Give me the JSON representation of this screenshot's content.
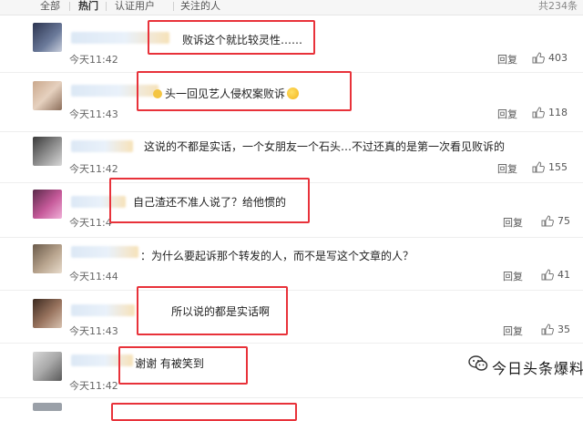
{
  "tabs": [
    "全部",
    "热门",
    "认证用户",
    "关注的人"
  ],
  "active_tab": "热门",
  "total_count": "共234条",
  "reply_label": "回复",
  "comments": [
    {
      "text": "败诉这个就比较灵性……",
      "time": "今天11:42",
      "likes": "403"
    },
    {
      "text": "头一回见艺人侵权案败诉",
      "time": "今天11:43",
      "likes": "118"
    },
    {
      "text": "这说的不都是实话，一个女朋友一个石头…不过还真的是第一次看见败诉的",
      "time": "今天11:42",
      "likes": "155"
    },
    {
      "text": "自己渣还不准人说了？给他惯的",
      "time": "今天11:4",
      "likes": "75"
    },
    {
      "text": "：为什么要起诉那个转发的人，而不是写这个文章的人？",
      "time": "今天11:44",
      "likes": "41"
    },
    {
      "text": "所以说的都是实话啊",
      "time": "今天11:43",
      "likes": "35"
    },
    {
      "text": "谢谢 有被笑到",
      "time": "今天11:42",
      "likes": ""
    }
  ],
  "watermark": "今日头条爆料",
  "colors": {
    "highlight_box": "#e8323a",
    "tab_bar": "#f6f6f6",
    "name_blur": "#dce8f5"
  },
  "icons": {
    "like": "thumbs-up-icon",
    "emoji": "smiley-icon",
    "watermark": "wechat-icon"
  }
}
